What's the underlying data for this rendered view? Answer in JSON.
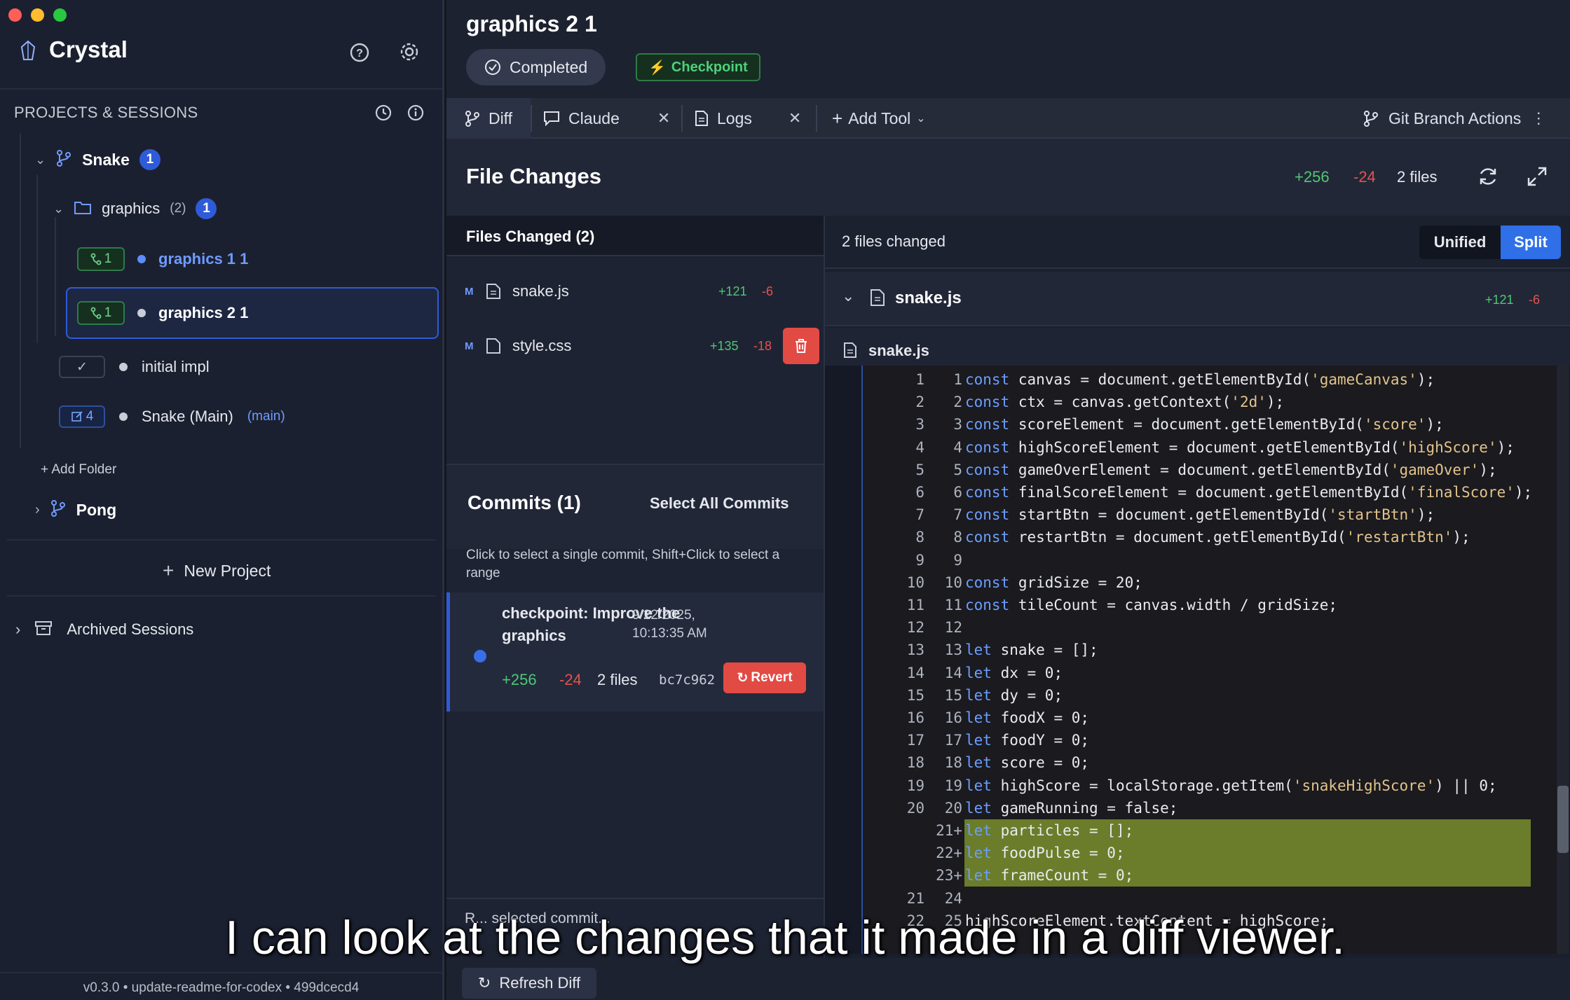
{
  "window": {
    "traffic_lights": [
      "#ff5f57",
      "#febc2e",
      "#28c840"
    ]
  },
  "sidebar": {
    "app_name": "Crystal",
    "section_title": "PROJECTS & SESSIONS",
    "projects": [
      {
        "name": "Snake",
        "badge": "1",
        "folder": {
          "name": "graphics",
          "count": "(2)",
          "badge": "1"
        },
        "sessions": [
          {
            "tag": "1",
            "name": "graphics 1 1",
            "selected": false
          },
          {
            "tag": "1",
            "name": "graphics 2 1",
            "selected": true
          }
        ],
        "other_sessions": [
          {
            "tag_icon": "check",
            "name": "initial impl"
          },
          {
            "tag": "4",
            "name": "Snake (Main)",
            "suffix": "(main)"
          }
        ],
        "add_folder": "+ Add Folder"
      },
      {
        "name": "Pong"
      }
    ],
    "new_project": "New Project",
    "archived": "Archived Sessions",
    "footer": "v0.3.0 • update-readme-for-codex • 499dcecd4"
  },
  "header": {
    "title": "graphics 2 1",
    "status": "Completed",
    "checkpoint": "Checkpoint"
  },
  "tabs": [
    {
      "label": "Diff",
      "active": true
    },
    {
      "label": "Claude",
      "closable": true
    },
    {
      "label": "Logs",
      "closable": true
    },
    {
      "label": "Add Tool"
    }
  ],
  "git_actions": "Git Branch Actions",
  "file_changes": {
    "title": "File Changes",
    "additions": "+256",
    "deletions": "-24",
    "files": "2 files"
  },
  "files_changed": {
    "title": "Files Changed (2)",
    "items": [
      {
        "status": "M",
        "name": "snake.js",
        "add": "+121",
        "del": "-6"
      },
      {
        "status": "M",
        "name": "style.css",
        "add": "+135",
        "del": "-18"
      }
    ]
  },
  "commits": {
    "title": "Commits (1)",
    "select_all": "Select All Commits",
    "hint": "Click to select a single commit, Shift+Click to select a range",
    "items": [
      {
        "message": "checkpoint: Improve the graphics",
        "date": "9/22/2025, 10:13:35 AM",
        "add": "+256",
        "del": "-24",
        "files": "2 files",
        "hash": "bc7c962",
        "revert": "Revert"
      }
    ],
    "partial_footer": "R... selected commit..."
  },
  "diff": {
    "summary": "2 files changed",
    "view_modes": [
      "Unified",
      "Split"
    ],
    "active_mode": "Split",
    "file": {
      "name": "snake.js",
      "add": "+121",
      "del": "-6"
    },
    "subfile": "snake.js",
    "lines": [
      {
        "o": "1",
        "n": "1",
        "t": "const canvas = document.getElementById('gameCanvas');"
      },
      {
        "o": "2",
        "n": "2",
        "t": "const ctx = canvas.getContext('2d');"
      },
      {
        "o": "3",
        "n": "3",
        "t": "const scoreElement = document.getElementById('score');"
      },
      {
        "o": "4",
        "n": "4",
        "t": "const highScoreElement = document.getElementById('highScore');"
      },
      {
        "o": "5",
        "n": "5",
        "t": "const gameOverElement = document.getElementById('gameOver');"
      },
      {
        "o": "6",
        "n": "6",
        "t": "const finalScoreElement = document.getElementById('finalScore');"
      },
      {
        "o": "7",
        "n": "7",
        "t": "const startBtn = document.getElementById('startBtn');"
      },
      {
        "o": "8",
        "n": "8",
        "t": "const restartBtn = document.getElementById('restartBtn');"
      },
      {
        "o": "9",
        "n": "9",
        "t": ""
      },
      {
        "o": "10",
        "n": "10",
        "t": "const gridSize = 20;"
      },
      {
        "o": "11",
        "n": "11",
        "t": "const tileCount = canvas.width / gridSize;"
      },
      {
        "o": "12",
        "n": "12",
        "t": ""
      },
      {
        "o": "13",
        "n": "13",
        "t": "let snake = [];"
      },
      {
        "o": "14",
        "n": "14",
        "t": "let dx = 0;"
      },
      {
        "o": "15",
        "n": "15",
        "t": "let dy = 0;"
      },
      {
        "o": "16",
        "n": "16",
        "t": "let foodX = 0;"
      },
      {
        "o": "17",
        "n": "17",
        "t": "let foodY = 0;"
      },
      {
        "o": "18",
        "n": "18",
        "t": "let score = 0;"
      },
      {
        "o": "19",
        "n": "19",
        "t": "let highScore = localStorage.getItem('snakeHighScore') || 0;"
      },
      {
        "o": "20",
        "n": "20",
        "t": "let gameRunning = false;"
      },
      {
        "o": "",
        "n": "21+",
        "t": "let particles = [];",
        "added": true
      },
      {
        "o": "",
        "n": "22+",
        "t": "let foodPulse = 0;",
        "added": true
      },
      {
        "o": "",
        "n": "23+",
        "t": "let frameCount = 0;",
        "added": true
      },
      {
        "o": "21",
        "n": "24",
        "t": ""
      },
      {
        "o": "22",
        "n": "25",
        "t": "highScoreElement.textContent = highScore;"
      }
    ]
  },
  "refresh": "Refresh Diff",
  "caption": "I can look at the changes that it made in a diff viewer."
}
